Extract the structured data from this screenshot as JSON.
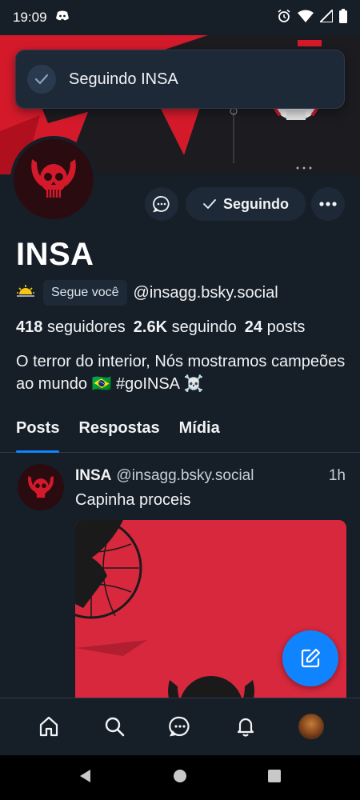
{
  "status_bar": {
    "time": "19:09"
  },
  "toast": {
    "message": "Seguindo INSA"
  },
  "profile": {
    "follow_button_label": "Seguindo",
    "name": "INSA",
    "follows_you_label": "Segue você",
    "handle": "@insagg.bsky.social",
    "stats": {
      "followers_count": "418",
      "followers_label": "seguidores",
      "following_count": "2.6K",
      "following_label": "seguindo",
      "posts_count": "24",
      "posts_label": "posts"
    },
    "bio": "O terror do interior, Nós mostramos campeões ao mundo 🇧🇷 #goINSA ☠️"
  },
  "tabs": [
    {
      "label": "Posts",
      "active": true
    },
    {
      "label": "Respostas",
      "active": false
    },
    {
      "label": "Mídia",
      "active": false
    }
  ],
  "post": {
    "author_name": "INSA",
    "author_handle": "@insagg.bsky.social",
    "time": "1h",
    "text": "Capinha proceis"
  },
  "colors": {
    "accent": "#1083fe",
    "background": "#161e27",
    "surface": "#1e2937",
    "brand_red": "#d8283e"
  },
  "icons": {
    "bottom_nav": [
      "home-icon",
      "search-icon",
      "chat-icon",
      "bell-icon",
      "profile-avatar"
    ],
    "system_nav": [
      "back-icon",
      "home-circle-icon",
      "recents-icon"
    ]
  }
}
